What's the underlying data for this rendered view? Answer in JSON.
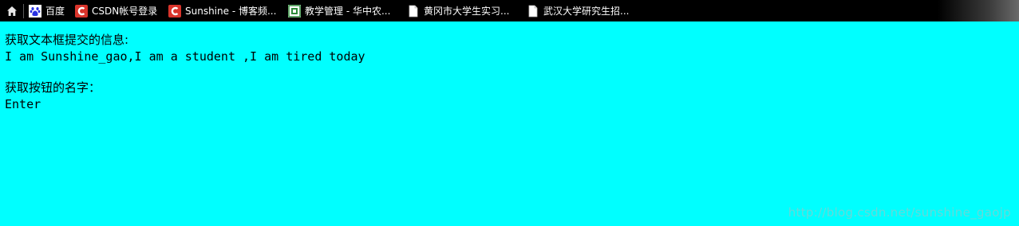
{
  "bookmarks_bar": {
    "items": [
      {
        "label": "百度",
        "icon": "baidu-paw-icon"
      },
      {
        "label": "CSDN帐号登录",
        "icon": "csdn-c-icon"
      },
      {
        "label": "Sunshine - 博客频...",
        "icon": "csdn-c-icon"
      },
      {
        "label": "教学管理 - 华中农...",
        "icon": "university-crest-icon"
      },
      {
        "label": "黄冈市大学生实习...",
        "icon": "page-icon"
      },
      {
        "label": "武汉大学研究生招...",
        "icon": "page-icon"
      }
    ],
    "colors": {
      "background": "#000000",
      "text": "#ffffff",
      "csdn_red": "#d9342b",
      "baidu_blue": "#2932e1"
    }
  },
  "page": {
    "background": "#00ffff",
    "textbox_label": "获取文本框提交的信息:",
    "textbox_value": "I am Sunshine_gao,I am a student ,I am tired today",
    "button_label": "获取按钮的名字：",
    "button_value": "Enter"
  },
  "watermark": "http://blog.csdn.net/sunshine_gaojp"
}
